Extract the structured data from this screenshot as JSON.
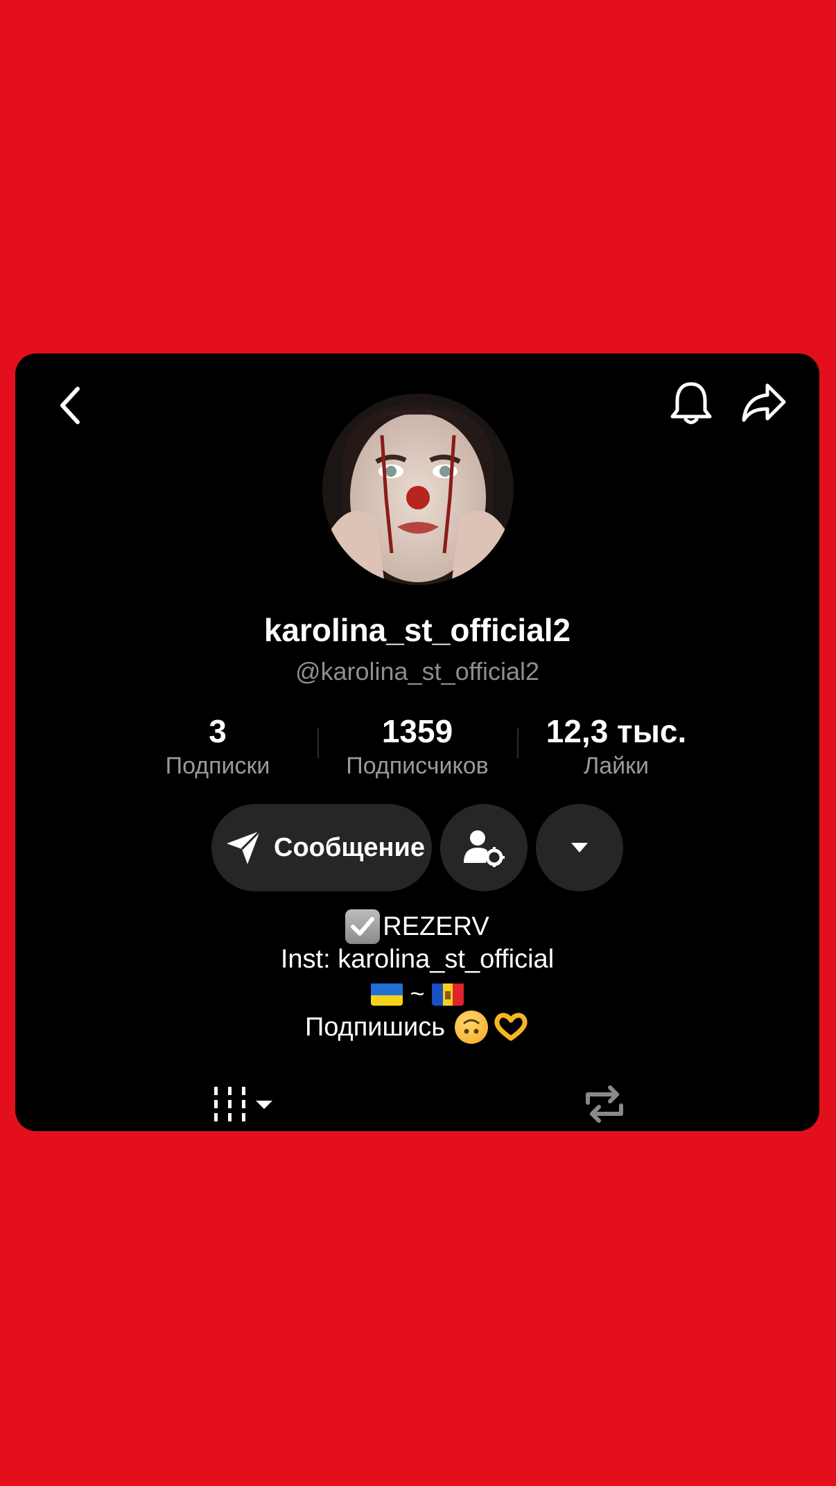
{
  "profile": {
    "display_name": "karolina_st_official2",
    "handle": "@karolina_st_official2"
  },
  "stats": [
    {
      "value": "3",
      "label": "Подписки"
    },
    {
      "value": "1359",
      "label": "Подписчиков"
    },
    {
      "value": "12,3 тыс.",
      "label": "Лайки"
    }
  ],
  "actions": {
    "message_label": "Сообщение"
  },
  "bio": {
    "line1": "REZERV",
    "line2": "Inst: karolina_st_official",
    "line3_separator": "~",
    "line4": "Подпишись"
  },
  "icons": {
    "back": "chevron-left-icon",
    "bell": "bell-icon",
    "share": "share-arrow-icon",
    "message": "paper-plane-icon",
    "user_settings": "user-gear-icon",
    "dropdown": "caret-down-icon",
    "videos_tab": "grid-icon",
    "reposts_tab": "repost-icon"
  },
  "colors": {
    "background": "#e30f1c",
    "card": "#000000",
    "button": "#262626",
    "muted_text": "#8e8e8e"
  }
}
